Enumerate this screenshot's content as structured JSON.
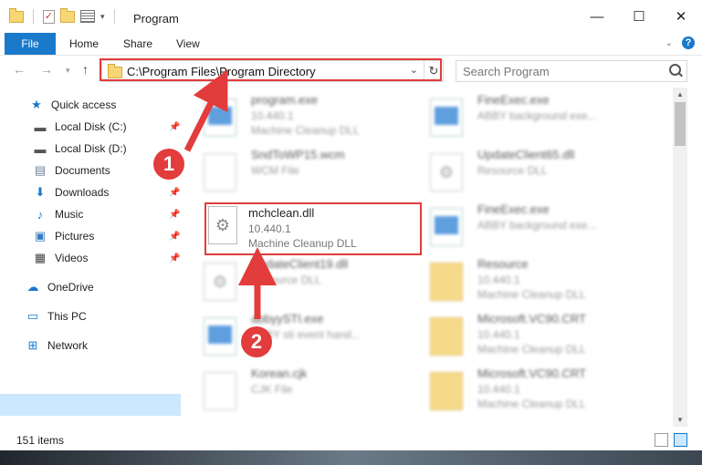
{
  "window": {
    "title": "Program",
    "controls": [
      "minimize-icon",
      "maximize-icon",
      "close-icon"
    ]
  },
  "ribbon": {
    "tabs": [
      "File",
      "Home",
      "Share",
      "View"
    ],
    "help_label": "?"
  },
  "address_bar": {
    "path": "C:\\Program Files\\Program Directory",
    "search_placeholder": "Search Program"
  },
  "sidebar": {
    "items": [
      {
        "label": "Quick access",
        "icon": "star-icon"
      },
      {
        "label": "Local Disk (C:)",
        "icon": "drive-icon",
        "pinned": true
      },
      {
        "label": "Local Disk (D:)",
        "icon": "drive-icon"
      },
      {
        "label": "Documents",
        "icon": "documents-icon",
        "pinned": true
      },
      {
        "label": "Downloads",
        "icon": "download-icon",
        "pinned": true
      },
      {
        "label": "Music",
        "icon": "music-icon",
        "pinned": true
      },
      {
        "label": "Pictures",
        "icon": "pictures-icon",
        "pinned": true
      },
      {
        "label": "Videos",
        "icon": "videos-icon",
        "pinned": true
      },
      {
        "label": "OneDrive",
        "icon": "cloud-icon"
      },
      {
        "label": "This PC",
        "icon": "computer-icon",
        "selected": true
      },
      {
        "label": "Network",
        "icon": "network-icon"
      }
    ]
  },
  "files": [
    {
      "name": "program.exe",
      "line2": "10.440.1",
      "line3": "Machine Cleanup DLL",
      "icon": "exe-icon"
    },
    {
      "name": "FineExec.exe",
      "line2": "ABBY background exe...",
      "line3": "",
      "icon": "exe-icon"
    },
    {
      "name": "SndToWP15.wcm",
      "line2": "WCM File",
      "line3": "",
      "icon": "file-icon"
    },
    {
      "name": "UpdateClient65.dll",
      "line2": "Resource DLL",
      "line3": "",
      "icon": "dll-icon"
    },
    {
      "name": "mchclean.dll",
      "line2": "10.440.1",
      "line3": "Machine Cleanup DLL",
      "icon": "dll-icon",
      "highlighted": true
    },
    {
      "name": "FineExec.exe",
      "line2": "ABBY background exe...",
      "line3": "",
      "icon": "exe-icon"
    },
    {
      "name": "UpdateClient19.dll",
      "line2": "Resource DLL",
      "line3": "",
      "icon": "dll-icon"
    },
    {
      "name": "Resource",
      "line2": "10.440.1",
      "line3": "Machine Cleanup DLL",
      "icon": "folder-icon"
    },
    {
      "name": "abbyySTI.exe",
      "line2": "ABBY sti event hand...",
      "line3": "",
      "icon": "exe-icon"
    },
    {
      "name": "Microsoft.VC90.CRT",
      "line2": "10.440.1",
      "line3": "Machine Cleanup DLL",
      "icon": "folder-icon"
    },
    {
      "name": "Korean.cjk",
      "line2": "CJK File",
      "line3": "",
      "icon": "file-icon"
    },
    {
      "name": "Microsoft.VC90.CRT",
      "line2": "10.440.1",
      "line3": "Machine Cleanup DLL",
      "icon": "folder-icon"
    }
  ],
  "status": {
    "items_count": "151 items"
  },
  "annotations": {
    "step1": "1",
    "step2": "2",
    "color": "#e23c3c"
  }
}
